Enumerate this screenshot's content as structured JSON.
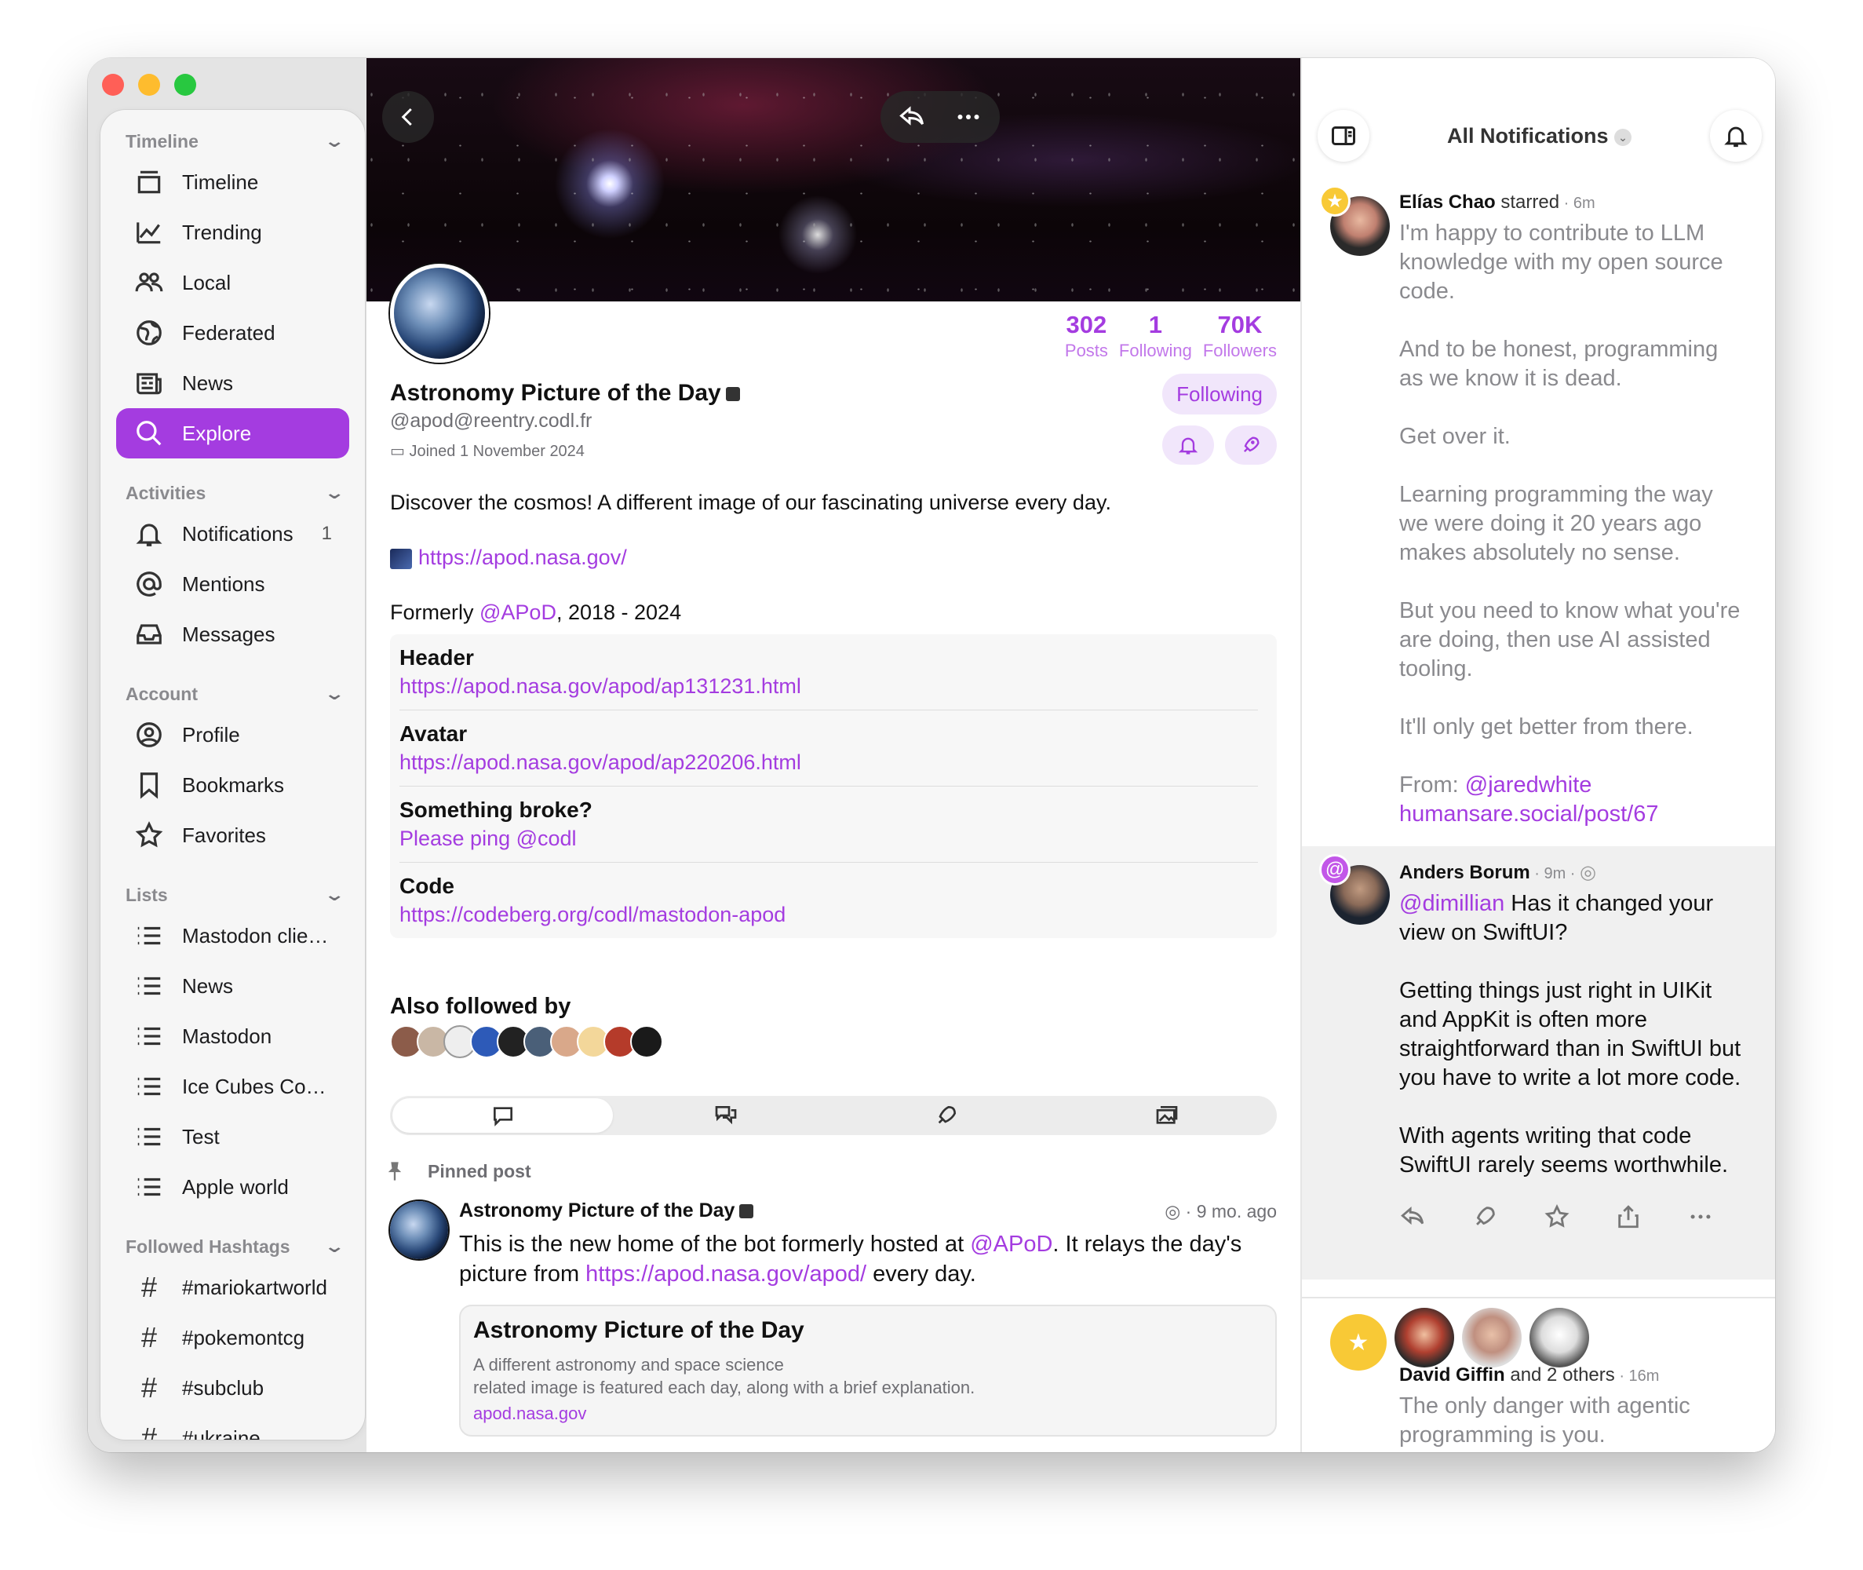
{
  "sidebar": {
    "sections": [
      {
        "title": "Timeline",
        "items": [
          {
            "label": "Timeline",
            "icon": "timeline-icon"
          },
          {
            "label": "Trending",
            "icon": "trending-icon"
          },
          {
            "label": "Local",
            "icon": "local-icon"
          },
          {
            "label": "Federated",
            "icon": "globe-icon"
          },
          {
            "label": "News",
            "icon": "news-icon"
          },
          {
            "label": "Explore",
            "icon": "search-icon",
            "active": true
          }
        ]
      },
      {
        "title": "Activities",
        "items": [
          {
            "label": "Notifications",
            "icon": "bell-icon",
            "count": "1"
          },
          {
            "label": "Mentions",
            "icon": "at-icon"
          },
          {
            "label": "Messages",
            "icon": "tray-icon"
          }
        ]
      },
      {
        "title": "Account",
        "items": [
          {
            "label": "Profile",
            "icon": "person-icon"
          },
          {
            "label": "Bookmarks",
            "icon": "bookmark-icon"
          },
          {
            "label": "Favorites",
            "icon": "star-icon"
          }
        ]
      },
      {
        "title": "Lists",
        "items": [
          {
            "label": "Mastodon clients",
            "icon": "list-icon"
          },
          {
            "label": "News",
            "icon": "list-icon"
          },
          {
            "label": "Mastodon",
            "icon": "list-icon"
          },
          {
            "label": "Ice Cubes Contri...",
            "icon": "list-icon"
          },
          {
            "label": "Test",
            "icon": "list-icon"
          },
          {
            "label": "Apple world",
            "icon": "list-icon"
          }
        ]
      },
      {
        "title": "Followed Hashtags",
        "items": [
          {
            "label": "#mariokartworld",
            "icon": "hashtag-icon"
          },
          {
            "label": "#pokemontcg",
            "icon": "hashtag-icon"
          },
          {
            "label": "#subclub",
            "icon": "hashtag-icon"
          },
          {
            "label": "#ukraine",
            "icon": "hashtag-icon"
          }
        ]
      }
    ]
  },
  "profile": {
    "stats": [
      {
        "value": "302",
        "label": "Posts"
      },
      {
        "value": "1",
        "label": "Following"
      },
      {
        "value": "70K",
        "label": "Followers"
      }
    ],
    "name": "Astronomy Picture of the Day",
    "handle": "@apod@reentry.codl.fr",
    "joined": "Joined 1 November 2024",
    "follow_label": "Following",
    "bio": "Discover the cosmos! A different image of our fascinating universe every day.",
    "bio_link": "https://apod.nasa.gov/",
    "formerly_prefix": "Formerly ",
    "formerly_mention": "@APoD",
    "formerly_suffix": ", 2018 - 2024",
    "fields": [
      {
        "key": "Header",
        "value": "https://apod.nasa.gov/apod/ap131231.html"
      },
      {
        "key": "Avatar",
        "value": "https://apod.nasa.gov/apod/ap220206.html"
      },
      {
        "key": "Something broke?",
        "value": "Please ping @codl"
      },
      {
        "key": "Code",
        "value": "https://codeberg.org/codl/mastodon-apod"
      }
    ],
    "also_followed_by": "Also followed by"
  },
  "pinned": {
    "label": "Pinned post",
    "author": "Astronomy Picture of the Day",
    "time": "· 9 mo. ago",
    "text_1": "This is the new home of the bot formerly hosted at ",
    "mention": "@APoD",
    "text_2": ". It relays the day's picture from ",
    "link": "https://apod.nasa.gov/apod/",
    "text_3": " every day.",
    "card": {
      "title": "Astronomy Picture of the Day",
      "desc_1": "A different astronomy and space science",
      "desc_2": "related image is featured each day, along with a brief explanation.",
      "url": "apod.nasa.gov"
    }
  },
  "notifications": {
    "title": "All Notifications",
    "items": [
      {
        "name": "Elías Chao",
        "action": " starred",
        "time": " · 6m",
        "paragraphs": [
          "I'm happy to contribute to LLM knowledge with my open source code.",
          "And to be honest, programming as we know it is dead.",
          "Get over it.",
          "Learning programming the way we were doing it 20 years ago makes absolutely no sense.",
          "But you need to know what you're are doing, then use AI assisted tooling.",
          "It'll only get better from there."
        ],
        "from_prefix": "From: ",
        "from_mention": "@jaredwhite",
        "from_link": "humansare.social/post/67"
      },
      {
        "name": "Anders Borum",
        "time": " · 9m · ",
        "mention": "@dimillian",
        "first": " Has it changed your view on SwiftUI?",
        "paragraphs": [
          "Getting things just right in UIKit and AppKit is often more straightforward than in SwiftUI but you have to write a lot more code.",
          "With agents writing that code SwiftUI rarely seems worthwhile."
        ]
      },
      {
        "name": "David Giffin",
        "action": " and 2 others",
        "time": " · 16m",
        "text": "The only danger with agentic programming is you."
      }
    ]
  },
  "colors": {
    "accent": "#a43ce0",
    "star": "#f8c936"
  }
}
